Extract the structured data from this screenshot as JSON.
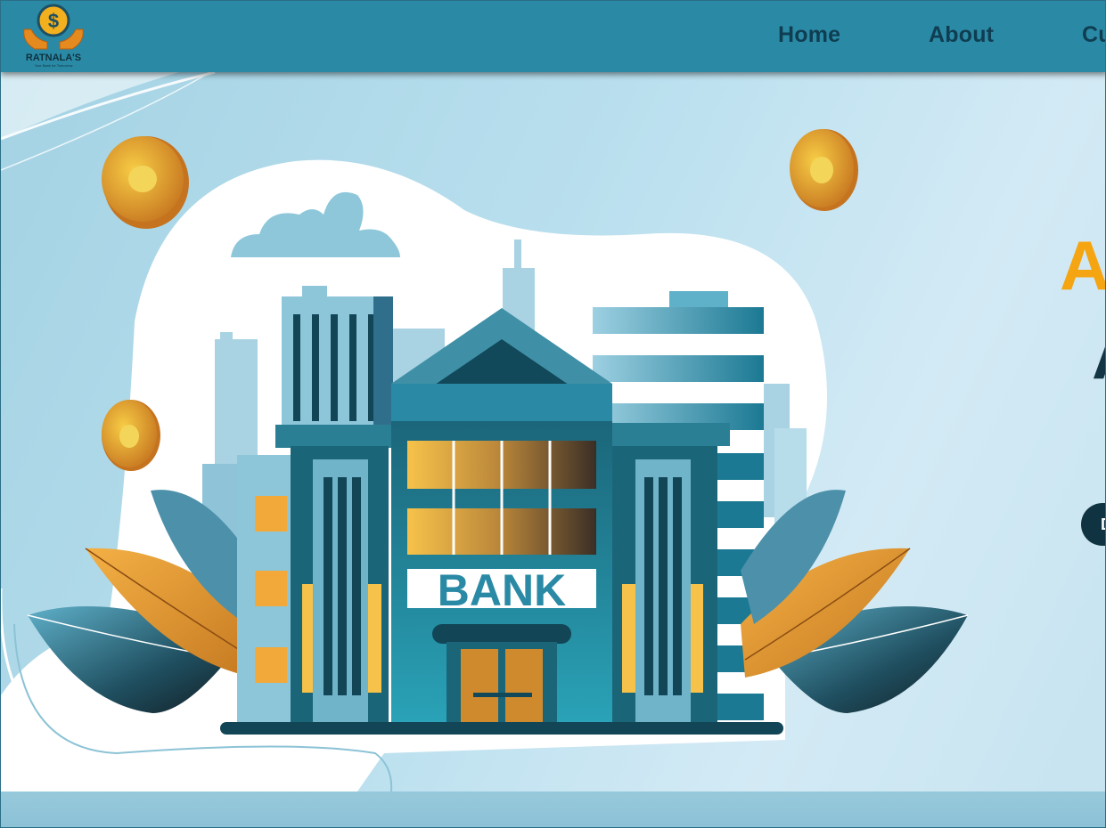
{
  "brand": {
    "name": "RATNALA'S",
    "tagline": "Your Bank for Tomorrow",
    "symbol": "$"
  },
  "nav": {
    "items": [
      {
        "label": "Home"
      },
      {
        "label": "About"
      },
      {
        "label": "Cu"
      }
    ]
  },
  "hero": {
    "illustration": {
      "sign_text": "BANK",
      "icon": "bank-building-illustration"
    },
    "title_line1": "A",
    "title_line2": "A",
    "cta_label": "D"
  },
  "colors": {
    "navbar": "#2a8aa5",
    "nav_text": "#0f3d52",
    "accent_orange": "#f5a412",
    "title_dark": "#143544",
    "cta_bg": "#0f3340"
  }
}
